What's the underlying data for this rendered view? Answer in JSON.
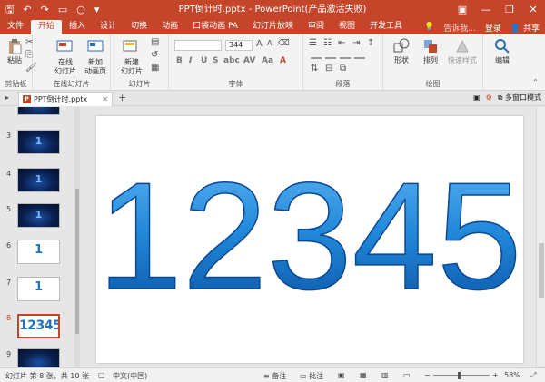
{
  "window": {
    "title": "PPT倒计时.pptx - PowerPoint(产品激活失败)"
  },
  "tabs": [
    {
      "label": "文件"
    },
    {
      "label": "开始",
      "active": true
    },
    {
      "label": "插入"
    },
    {
      "label": "设计"
    },
    {
      "label": "切换"
    },
    {
      "label": "动画"
    },
    {
      "label": "口袋动画 PA"
    },
    {
      "label": "幻灯片放映"
    },
    {
      "label": "审阅"
    },
    {
      "label": "视图"
    },
    {
      "label": "开发工具"
    }
  ],
  "tellme": "告诉我...",
  "account": {
    "login": "登录",
    "share": "共享"
  },
  "ribbon": {
    "clipboard": {
      "paste": "粘贴",
      "label": "剪贴板"
    },
    "online": {
      "online_slides": "在线\n幻灯片",
      "label": "在线幻灯片",
      "new_page": "新加\n动画页"
    },
    "slides": {
      "new_slide": "新建\n幻灯片",
      "label": "幻灯片"
    },
    "font": {
      "size": "344",
      "label": "字体"
    },
    "paragraph": {
      "label": "段落"
    },
    "drawing": {
      "shapes": "形状",
      "arrange": "排列",
      "quick_styles": "快速样式",
      "label": "绘图"
    },
    "editing": {
      "edit": "编辑"
    }
  },
  "document": {
    "tab_name": "PPT倒计时.pptx",
    "multiwindow": "多窗口模式"
  },
  "slides": [
    {
      "num": "",
      "style": "dark",
      "mark": "",
      "selected": false
    },
    {
      "num": "3",
      "style": "dark",
      "mark": "1",
      "selected": false
    },
    {
      "num": "4",
      "style": "dark",
      "mark": "1",
      "selected": false
    },
    {
      "num": "5",
      "style": "dark",
      "mark": "1",
      "selected": false
    },
    {
      "num": "6",
      "style": "light",
      "mark": "1",
      "selected": false
    },
    {
      "num": "7",
      "style": "light",
      "mark": "1",
      "selected": false
    },
    {
      "num": "8",
      "style": "light",
      "mark": "12345",
      "selected": true
    },
    {
      "num": "9",
      "style": "dark",
      "mark": "",
      "selected": false
    }
  ],
  "current_slide": {
    "text": "12345",
    "colors": {
      "light": "#5fb6f5",
      "mid": "#1f86d8",
      "dark": "#0b4fa0"
    }
  },
  "statusbar": {
    "slide_info": "幻灯片 第 8 张，共 10 张",
    "language": "中文(中国)",
    "notes": "备注",
    "comments": "批注",
    "zoom": "58%"
  },
  "colors": {
    "accent": "#c4452a"
  }
}
